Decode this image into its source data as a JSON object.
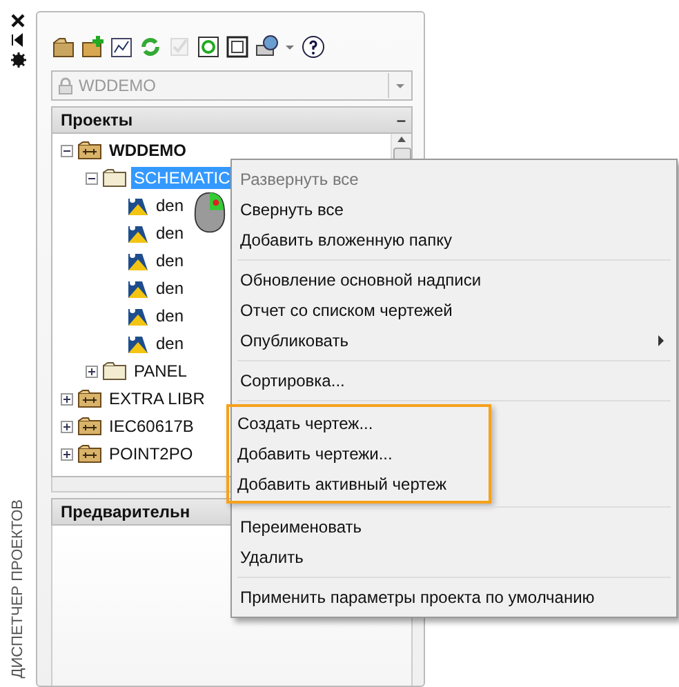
{
  "side_strip": {
    "title": "ДИСПЕТЧЕР ПРОЕКТОВ"
  },
  "toolbar": [
    {
      "kind": "open",
      "disabled": false
    },
    {
      "kind": "new",
      "disabled": false
    },
    {
      "kind": "properties",
      "disabled": false
    },
    {
      "kind": "refresh",
      "disabled": false
    },
    {
      "kind": "check",
      "disabled": true
    },
    {
      "kind": "update",
      "disabled": false
    },
    {
      "kind": "sheet",
      "disabled": false
    },
    {
      "kind": "publish",
      "disabled": false
    },
    {
      "kind": "dropdown",
      "disabled": false
    },
    {
      "kind": "help",
      "disabled": false
    }
  ],
  "project_select": {
    "value": "WDDEMO"
  },
  "projects_section": {
    "title": "Проекты",
    "collapse": "–"
  },
  "tree": [
    {
      "label": "WDDEMO",
      "kind": "project",
      "active": true,
      "expanded": true,
      "selected": false,
      "children": [
        {
          "label": "SCHEMATIC",
          "kind": "folder",
          "expanded": true,
          "selected": true,
          "children": [
            {
              "label": "den",
              "kind": "drawing",
              "selected": false
            },
            {
              "label": "den",
              "kind": "drawing",
              "selected": false
            },
            {
              "label": "den",
              "kind": "drawing",
              "selected": false
            },
            {
              "label": "den",
              "kind": "drawing",
              "selected": false
            },
            {
              "label": "den",
              "kind": "drawing",
              "selected": false
            },
            {
              "label": "den",
              "kind": "drawing",
              "selected": false
            }
          ]
        },
        {
          "label": "PANEL",
          "kind": "folder",
          "expanded": false,
          "selected": false
        }
      ]
    },
    {
      "label": "EXTRA LIBR",
      "kind": "project",
      "active": false,
      "expanded": false,
      "selected": false
    },
    {
      "label": "IEC60617B",
      "kind": "project",
      "active": false,
      "expanded": false,
      "selected": false
    },
    {
      "label": "POINT2PO",
      "kind": "project",
      "active": false,
      "expanded": false,
      "selected": false
    }
  ],
  "preview_section": {
    "title": "Предварительн"
  },
  "context_menu": {
    "groups": [
      {
        "highlighted": false,
        "items": [
          {
            "label": "Развернуть все",
            "disabled": true,
            "submenu": false
          },
          {
            "label": "Свернуть все",
            "disabled": false,
            "submenu": false
          },
          {
            "label": "Добавить вложенную папку",
            "disabled": false,
            "submenu": false
          }
        ]
      },
      {
        "highlighted": false,
        "items": [
          {
            "label": "Обновление основной надписи",
            "disabled": false,
            "submenu": false
          },
          {
            "label": "Отчет со списком чертежей",
            "disabled": false,
            "submenu": false
          },
          {
            "label": "Опубликовать",
            "disabled": false,
            "submenu": true
          }
        ]
      },
      {
        "highlighted": false,
        "items": [
          {
            "label": "Сортировка...",
            "disabled": false,
            "submenu": false
          }
        ]
      },
      {
        "highlighted": true,
        "items": [
          {
            "label": "Создать чертеж...",
            "disabled": false,
            "submenu": false
          },
          {
            "label": "Добавить чертежи...",
            "disabled": false,
            "submenu": false
          },
          {
            "label": "Добавить активный чертеж",
            "disabled": false,
            "submenu": false
          }
        ]
      },
      {
        "highlighted": false,
        "items": [
          {
            "label": "Переименовать",
            "disabled": false,
            "submenu": false
          },
          {
            "label": "Удалить",
            "disabled": false,
            "submenu": false
          }
        ]
      },
      {
        "highlighted": false,
        "items": [
          {
            "label": "Применить параметры проекта по умолчанию",
            "disabled": false,
            "submenu": false
          }
        ]
      }
    ]
  }
}
